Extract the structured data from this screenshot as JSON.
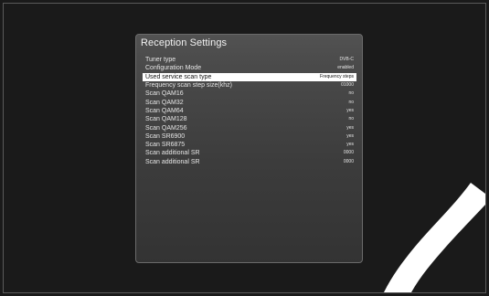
{
  "window": {
    "title": "Reception Settings"
  },
  "settings": [
    {
      "label": "Tuner type",
      "value": "DVB-C"
    },
    {
      "label": "Configuration Mode",
      "value": "enabled"
    },
    {
      "label": "Used service scan type",
      "value": "Frequency steps",
      "selected": true
    },
    {
      "label": "Frequency scan step size(khz)",
      "value": "01000"
    },
    {
      "label": "Scan QAM16",
      "value": "no"
    },
    {
      "label": "Scan QAM32",
      "value": "no"
    },
    {
      "label": "Scan QAM64",
      "value": "yes"
    },
    {
      "label": "Scan QAM128",
      "value": "no"
    },
    {
      "label": "Scan QAM256",
      "value": "yes"
    },
    {
      "label": "Scan SR6900",
      "value": "yes"
    },
    {
      "label": "Scan SR6875",
      "value": "yes"
    },
    {
      "label": "Scan additional SR",
      "value": "0000"
    },
    {
      "label": "Scan additional SR",
      "value": "0000"
    }
  ],
  "colors": {
    "background": "#1a1a1a",
    "panel": "#4b4b4b",
    "selection": "#ffffff",
    "decoration": "#ffffff"
  }
}
